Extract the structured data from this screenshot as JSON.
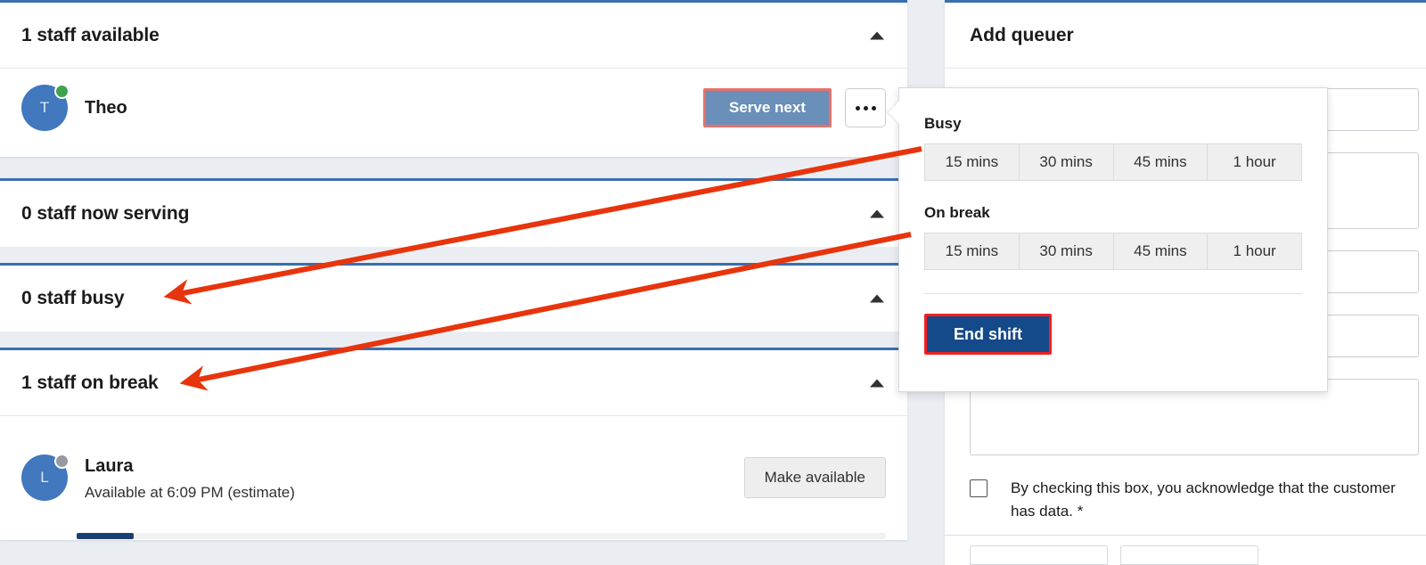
{
  "colors": {
    "accent_blue": "#3a6fb0",
    "avatar_blue": "#4178be",
    "navy": "#154a8a",
    "progress_fill": "#1c3f73",
    "annotation_red": "#e8340c",
    "highlight_red": "#ef2020",
    "serve_button_fill": "#6a8fb8",
    "serve_button_border": "#e8716a",
    "status_online": "#3fa34d",
    "status_away": "#949aa0",
    "page_bg": "#eaeef3"
  },
  "sections": [
    {
      "id": "available",
      "title": "1 staff available",
      "collapse_icon": "chevron-up-icon",
      "staff": [
        {
          "name": "Theo",
          "initial": "T",
          "status": "online",
          "subtitle": null,
          "primary_action": "Serve next",
          "kebab_icon": "ellipsis-icon"
        }
      ]
    },
    {
      "id": "now-serving",
      "title": "0 staff now serving",
      "collapse_icon": "chevron-up-icon",
      "staff": []
    },
    {
      "id": "busy",
      "title": "0 staff busy",
      "collapse_icon": "chevron-up-icon",
      "staff": []
    },
    {
      "id": "on-break",
      "title": "1 staff on break",
      "collapse_icon": "chevron-up-icon",
      "staff": [
        {
          "name": "Laura",
          "initial": "L",
          "status": "away",
          "subtitle": "Available at 6:09 PM (estimate)",
          "primary_action": "Make available",
          "progress_percent": 7
        }
      ]
    }
  ],
  "popover": {
    "busy_label": "Busy",
    "busy_options": [
      "15 mins",
      "30 mins",
      "45 mins",
      "1 hour"
    ],
    "break_label": "On break",
    "break_options": [
      "15 mins",
      "30 mins",
      "45 mins",
      "1 hour"
    ],
    "end_shift_label": "End shift"
  },
  "right_panel": {
    "title": "Add queuer",
    "consent_text": "By checking this box, you acknowledge that the customer has",
    "consent_text_line2": "data. *",
    "checkbox_checked": false
  }
}
